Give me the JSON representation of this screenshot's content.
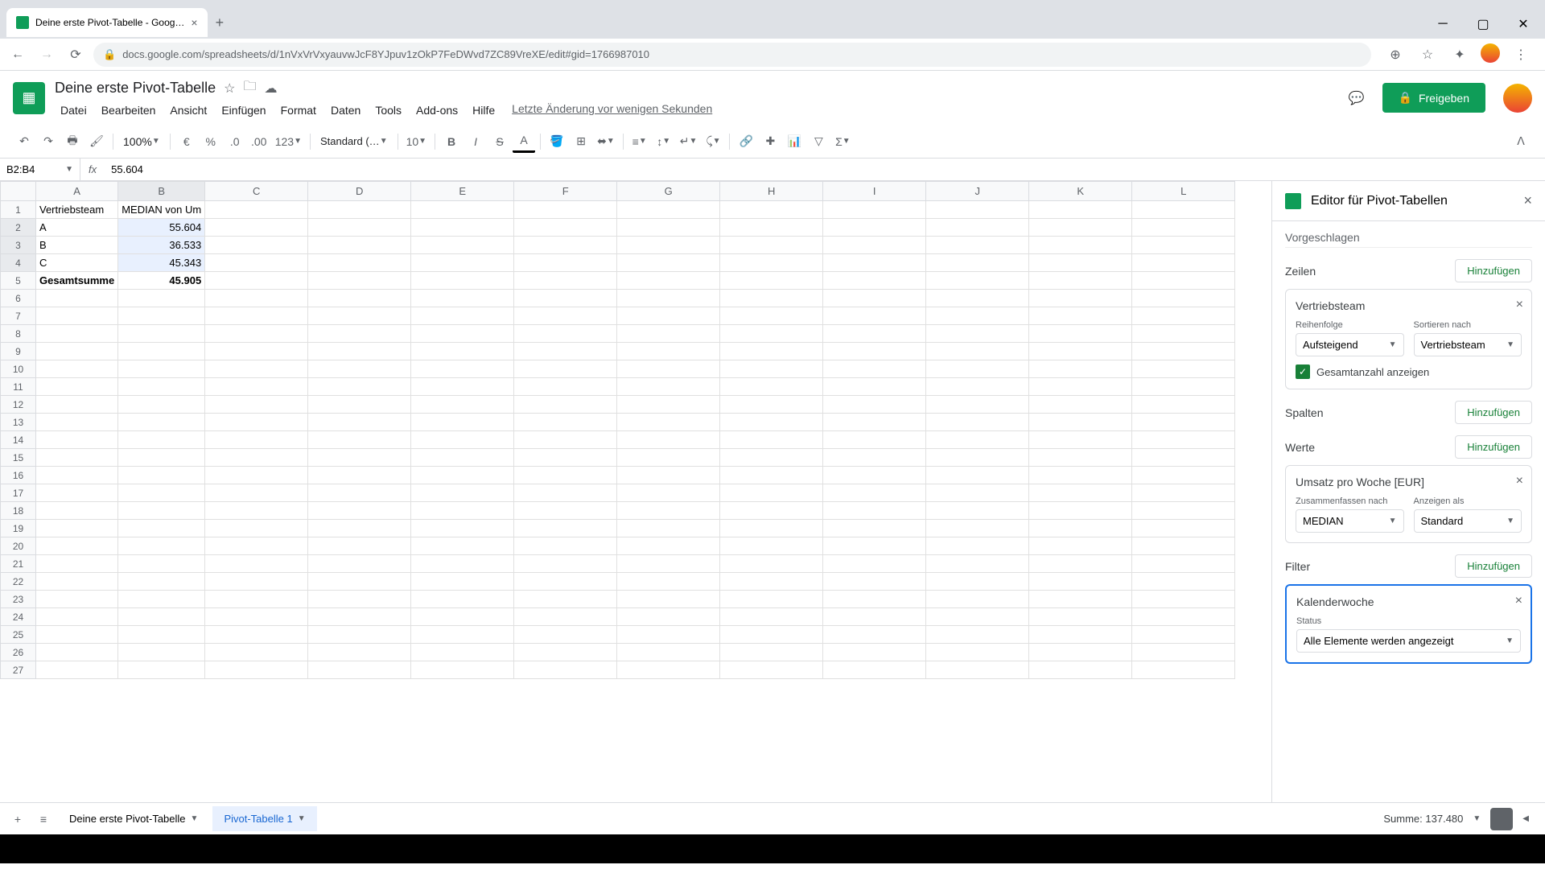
{
  "browser": {
    "tab_title": "Deine erste Pivot-Tabelle - Goog…",
    "url": "docs.google.com/spreadsheets/d/1nVxVrVxyauvwJcF8YJpuv1zOkP7FeDWvd7ZC89VreXE/edit#gid=1766987010"
  },
  "doc": {
    "title": "Deine erste Pivot-Tabelle",
    "last_edit": "Letzte Änderung vor wenigen Sekunden",
    "share_label": "Freigeben"
  },
  "menus": [
    "Datei",
    "Bearbeiten",
    "Ansicht",
    "Einfügen",
    "Format",
    "Daten",
    "Tools",
    "Add-ons",
    "Hilfe"
  ],
  "toolbar": {
    "zoom": "100%",
    "font": "Standard (…",
    "font_size": "10",
    "number_fmt": "123"
  },
  "formula": {
    "name_box": "B2:B4",
    "value": "55.604"
  },
  "columns": [
    "A",
    "B",
    "C",
    "D",
    "E",
    "F",
    "G",
    "H",
    "I",
    "J",
    "K",
    "L"
  ],
  "rows": [
    {
      "n": 1,
      "a": "Vertriebsteam",
      "b": "MEDIAN von Um",
      "header": true
    },
    {
      "n": 2,
      "a": "A",
      "b": "55.604",
      "sel": true
    },
    {
      "n": 3,
      "a": "B",
      "b": "36.533",
      "sel": true
    },
    {
      "n": 4,
      "a": "C",
      "b": "45.343",
      "sel": true
    },
    {
      "n": 5,
      "a": "Gesamtsumme",
      "b": "45.905",
      "bold": true
    }
  ],
  "empty_rows": [
    6,
    7,
    8,
    9,
    10,
    11,
    12,
    13,
    14,
    15,
    16,
    17,
    18,
    19,
    20,
    21,
    22,
    23,
    24,
    25,
    26,
    27
  ],
  "pivot": {
    "title": "Editor für Pivot-Tabellen",
    "suggested": "Vorgeschlagen",
    "sections": {
      "rows": {
        "title": "Zeilen",
        "add": "Hinzufügen"
      },
      "cols": {
        "title": "Spalten",
        "add": "Hinzufügen"
      },
      "values": {
        "title": "Werte",
        "add": "Hinzufügen"
      },
      "filters": {
        "title": "Filter",
        "add": "Hinzufügen"
      }
    },
    "row_card": {
      "title": "Vertriebsteam",
      "order_label": "Reihenfolge",
      "order_value": "Aufsteigend",
      "sort_label": "Sortieren nach",
      "sort_value": "Vertriebsteam",
      "show_totals": "Gesamtanzahl anzeigen"
    },
    "value_card": {
      "title": "Umsatz pro Woche [EUR]",
      "summarize_label": "Zusammenfassen nach",
      "summarize_value": "MEDIAN",
      "show_as_label": "Anzeigen als",
      "show_as_value": "Standard"
    },
    "filter_card": {
      "title": "Kalenderwoche",
      "status_label": "Status",
      "status_value": "Alle Elemente werden angezeigt"
    }
  },
  "sheets": {
    "tab1": "Deine erste Pivot-Tabelle",
    "tab2": "Pivot-Tabelle 1"
  },
  "status": {
    "sum": "Summe: 137.480"
  }
}
